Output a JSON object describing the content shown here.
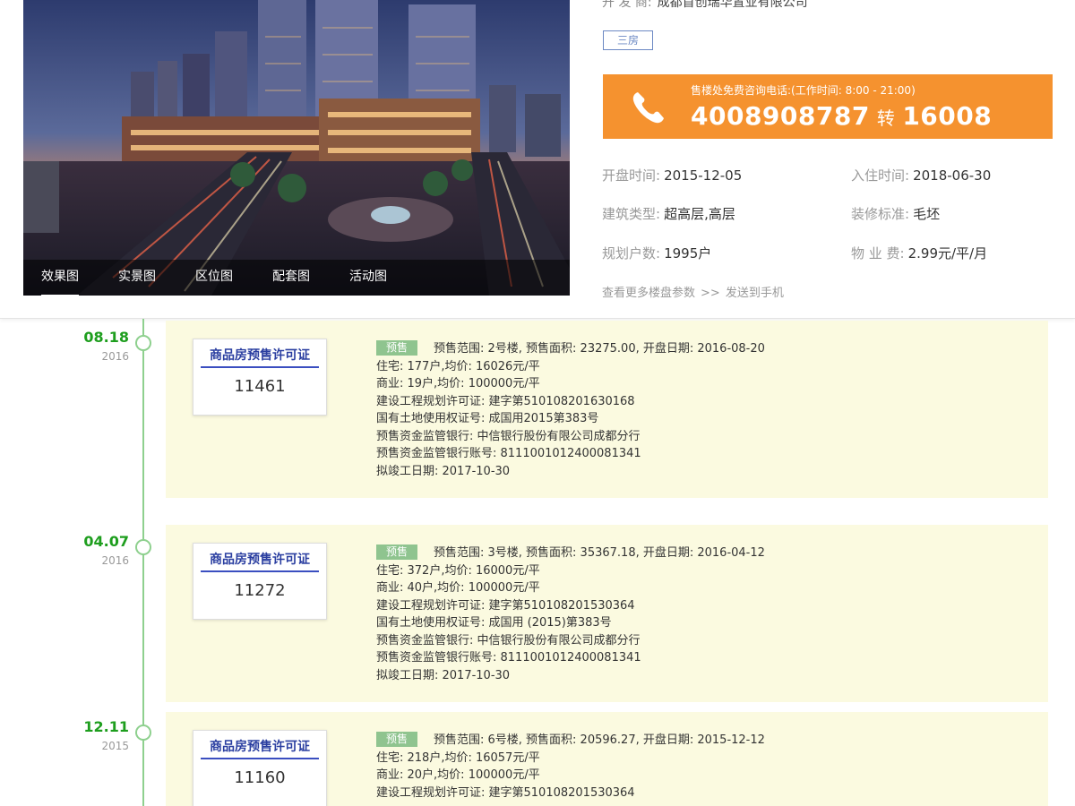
{
  "developer": {
    "label": "开 发 商:",
    "value": "成都首创瑞华置业有限公司"
  },
  "tag": "三房",
  "gallery_tabs": [
    "效果图",
    "实景图",
    "区位图",
    "配套图",
    "活动图"
  ],
  "phone": {
    "hint": "售楼处免费咨询电话:(工作时间: 8:00 - 21:00)",
    "main": "4008908787",
    "zhuan": "转",
    "ext": "16008"
  },
  "params": {
    "open_label": "开盘时间:",
    "open_value": "2015-12-05",
    "move_label": "入住时间:",
    "move_value": "2018-06-30",
    "type_label": "建筑类型:",
    "type_value": "超高层,高层",
    "deco_label": "装修标准:",
    "deco_value": "毛坯",
    "households_label": "规划户数:",
    "households_value": "1995户",
    "fee_label": "物 业 费:",
    "fee_value": "2.99元/平/月"
  },
  "links": {
    "more": "查看更多楼盘参数",
    "sep": ">>",
    "send": "发送到手机"
  },
  "entries": [
    {
      "date": "08.18",
      "year": "2016",
      "cert_title": "商品房预售许可证",
      "cert_no": "11461",
      "badge": "预售",
      "first_line": "预售范围: 2号楼, 预售面积: 23275.00, 开盘日期: 2016-08-20",
      "lines": [
        "住宅: 177户,均价: 16026元/平",
        "商业: 19户,均价: 100000元/平",
        "建设工程规划许可证: 建字第510108201630168",
        "国有土地使用权证号: 成国用2015第383号",
        "预售资金监管银行: 中信银行股份有限公司成都分行",
        "预售资金监管银行账号: 8111001012400081341",
        "拟竣工日期: 2017-10-30"
      ]
    },
    {
      "date": "04.07",
      "year": "2016",
      "cert_title": "商品房预售许可证",
      "cert_no": "11272",
      "badge": "预售",
      "first_line": "预售范围: 3号楼, 预售面积: 35367.18, 开盘日期: 2016-04-12",
      "lines": [
        "住宅: 372户,均价: 16000元/平",
        "商业: 40户,均价: 100000元/平",
        "建设工程规划许可证: 建字第510108201530364",
        "国有土地使用权证号: 成国用 (2015)第383号",
        "预售资金监管银行: 中信银行股份有限公司成都分行",
        "预售资金监管银行账号: 8111001012400081341",
        "拟竣工日期: 2017-10-30"
      ]
    },
    {
      "date": "12.11",
      "year": "2015",
      "cert_title": "商品房预售许可证",
      "cert_no": "11160",
      "badge": "预售",
      "first_line": "预售范围: 6号楼, 预售面积: 20596.27, 开盘日期: 2015-12-12",
      "lines": [
        "住宅: 218户,均价: 16057元/平",
        "商业: 20户,均价: 100000元/平",
        "建设工程规划许可证: 建字第510108201530364"
      ]
    }
  ],
  "colors": {
    "accent_orange": "#f5922f",
    "timeline_green": "#1e9e1e",
    "entry_bg": "#fbfae0",
    "badge_green": "#8fc48f",
    "cert_blue": "#2a3ea0"
  }
}
